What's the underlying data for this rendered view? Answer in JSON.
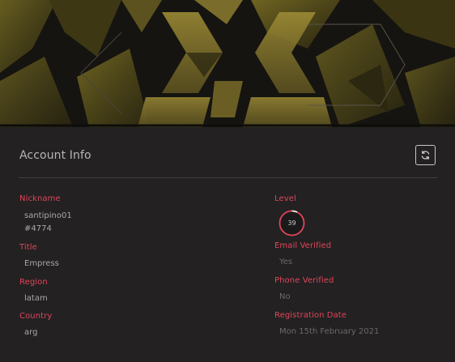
{
  "card": {
    "title": "Account Info",
    "refresh_icon": "refresh-icon"
  },
  "left_fields": {
    "nickname": {
      "label": "Nickname",
      "value_line1": "santipino01",
      "value_line2": "#4774"
    },
    "title": {
      "label": "Title",
      "value": "Empress"
    },
    "region": {
      "label": "Region",
      "value": "latam"
    },
    "country": {
      "label": "Country",
      "value": "arg"
    }
  },
  "right_fields": {
    "level": {
      "label": "Level",
      "value": "39"
    },
    "email_verified": {
      "label": "Email Verified",
      "value": "Yes"
    },
    "phone_verified": {
      "label": "Phone Verified",
      "value": "No"
    },
    "registration_date": {
      "label": "Registration Date",
      "value": "Mon 15th February 2021"
    }
  },
  "colors": {
    "accent": "#e0455a",
    "background": "#232122",
    "banner_gold": "#8a7a2a"
  }
}
